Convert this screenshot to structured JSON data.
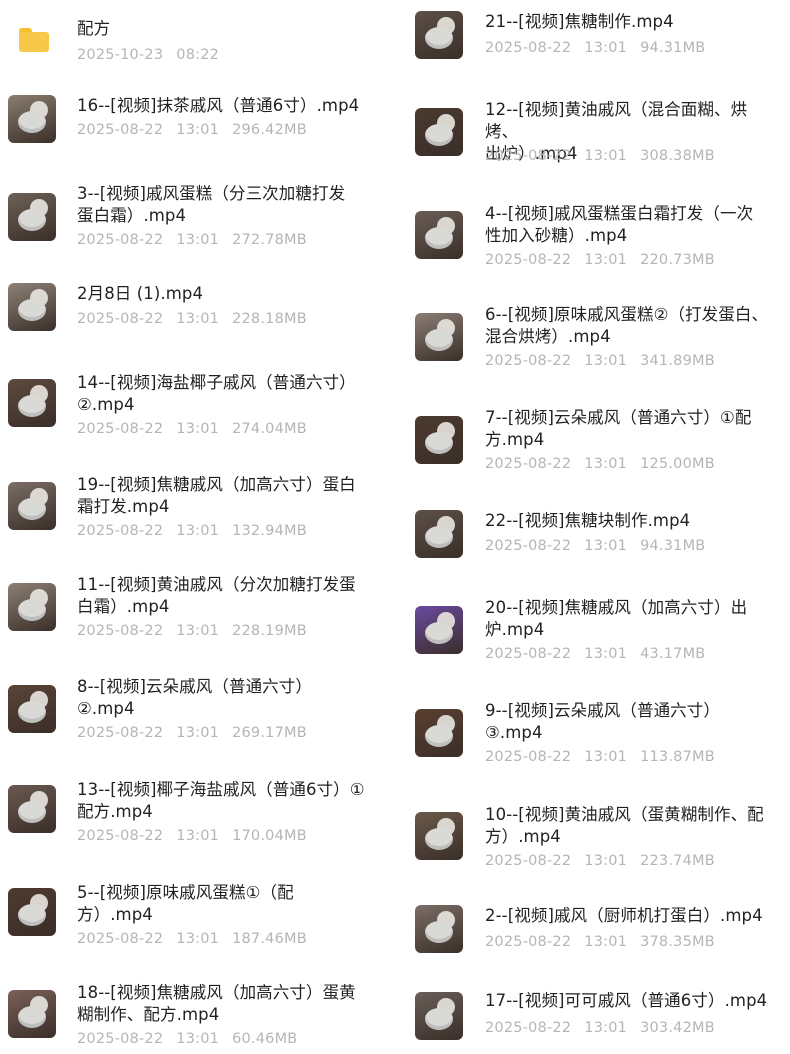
{
  "left": [
    {
      "name": "配方",
      "date": "2025-10-23",
      "time": "08:22",
      "size": "",
      "type": "folder",
      "icon": "folder-icon"
    },
    {
      "name": "16--[视频]抹茶戚风（普通6寸）.mp4",
      "date": "2025-08-22",
      "time": "13:01",
      "size": "296.42MB",
      "type": "video",
      "icon": "video-thumbnail",
      "thumb": "#8a7d70"
    },
    {
      "name": "3--[视频]戚风蛋糕（分三次加糖打发\n蛋白霜）.mp4",
      "date": "2025-08-22",
      "time": "13:01",
      "size": "272.78MB",
      "type": "video",
      "icon": "video-thumbnail",
      "thumb": "#6e6156"
    },
    {
      "name": "2月8日 (1).mp4",
      "date": "2025-08-22",
      "time": "13:01",
      "size": "228.18MB",
      "type": "video",
      "icon": "video-thumbnail",
      "thumb": "#8f8278"
    },
    {
      "name": "14--[视频]海盐椰子戚风（普通六寸）\n②.mp4",
      "date": "2025-08-22",
      "time": "13:01",
      "size": "274.04MB",
      "type": "video",
      "icon": "video-thumbnail",
      "thumb": "#5e4a40"
    },
    {
      "name": "19--[视频]焦糖戚风（加高六寸）蛋白\n霜打发.mp4",
      "date": "2025-08-22",
      "time": "13:01",
      "size": "132.94MB",
      "type": "video",
      "icon": "video-thumbnail",
      "thumb": "#7a6e66"
    },
    {
      "name": "11--[视频]黄油戚风（分次加糖打发蛋\n白霜）.mp4",
      "date": "2025-08-22",
      "time": "13:01",
      "size": "228.19MB",
      "type": "video",
      "icon": "video-thumbnail",
      "thumb": "#8c8076"
    },
    {
      "name": "8--[视频]云朵戚风（普通六寸）\n②.mp4",
      "date": "2025-08-22",
      "time": "13:01",
      "size": "269.17MB",
      "type": "video",
      "icon": "video-thumbnail",
      "thumb": "#5a4438"
    },
    {
      "name": "13--[视频]椰子海盐戚风（普通6寸）①\n配方.mp4",
      "date": "2025-08-22",
      "time": "13:01",
      "size": "170.04MB",
      "type": "video",
      "icon": "video-thumbnail",
      "thumb": "#6a5a50"
    },
    {
      "name": "5--[视频]原味戚风蛋糕①（配\n方）.mp4",
      "date": "2025-08-22",
      "time": "13:01",
      "size": "187.46MB",
      "type": "video",
      "icon": "video-thumbnail",
      "thumb": "#4e3a30"
    },
    {
      "name": "18--[视频]焦糖戚风（加高六寸）蛋黄\n糊制作、配方.mp4",
      "date": "2025-08-22",
      "time": "13:01",
      "size": "60.46MB",
      "type": "video",
      "icon": "video-thumbnail",
      "thumb": "#7a6058"
    }
  ],
  "right": [
    {
      "name": "21--[视频]焦糖制作.mp4",
      "date": "2025-08-22",
      "time": "13:01",
      "size": "94.31MB",
      "type": "video",
      "icon": "video-thumbnail",
      "thumb": "#5c5048"
    },
    {
      "name": "12--[视频]黄油戚风（混合面糊、烘烤、\n出炉）.mp4",
      "date": "2025-08-22",
      "time": "13:01",
      "size": "308.38MB",
      "type": "video",
      "icon": "video-thumbnail",
      "thumb": "#4a3a30"
    },
    {
      "name": "4--[视频]戚风蛋糕蛋白霜打发（一次\n性加入砂糖）.mp4",
      "date": "2025-08-22",
      "time": "13:01",
      "size": "220.73MB",
      "type": "video",
      "icon": "video-thumbnail",
      "thumb": "#6a5e56"
    },
    {
      "name": "6--[视频]原味戚风蛋糕②（打发蛋白、\n混合烘烤）.mp4",
      "date": "2025-08-22",
      "time": "13:01",
      "size": "341.89MB",
      "type": "video",
      "icon": "video-thumbnail",
      "thumb": "#8a7e76"
    },
    {
      "name": "7--[视频]云朵戚风（普通六寸）①配\n方.mp4",
      "date": "2025-08-22",
      "time": "13:01",
      "size": "125.00MB",
      "type": "video",
      "icon": "video-thumbnail",
      "thumb": "#4c3a30"
    },
    {
      "name": "22--[视频]焦糖块制作.mp4",
      "date": "2025-08-22",
      "time": "13:01",
      "size": "94.31MB",
      "type": "video",
      "icon": "video-thumbnail",
      "thumb": "#5c5048"
    },
    {
      "name": "20--[视频]焦糖戚风（加高六寸）出\n炉.mp4",
      "date": "2025-08-22",
      "time": "13:01",
      "size": "43.17MB",
      "type": "video",
      "icon": "video-thumbnail",
      "thumb": "#6a4aa0"
    },
    {
      "name": "9--[视频]云朵戚风（普通六寸）\n③.mp4",
      "date": "2025-08-22",
      "time": "13:01",
      "size": "113.87MB",
      "type": "video",
      "icon": "video-thumbnail",
      "thumb": "#5a4030"
    },
    {
      "name": "10--[视频]黄油戚风（蛋黄糊制作、配\n方）.mp4",
      "date": "2025-08-22",
      "time": "13:01",
      "size": "223.74MB",
      "type": "video",
      "icon": "video-thumbnail",
      "thumb": "#6a5a4a"
    },
    {
      "name": "2--[视频]戚风（厨师机打蛋白）.mp4",
      "date": "2025-08-22",
      "time": "13:01",
      "size": "378.35MB",
      "type": "video",
      "icon": "video-thumbnail",
      "thumb": "#7a6e66"
    },
    {
      "name": "17--[视频]可可戚风（普通6寸）.mp4",
      "date": "2025-08-22",
      "time": "13:01",
      "size": "303.42MB",
      "type": "video",
      "icon": "video-thumbnail",
      "thumb": "#6a5e58"
    }
  ]
}
